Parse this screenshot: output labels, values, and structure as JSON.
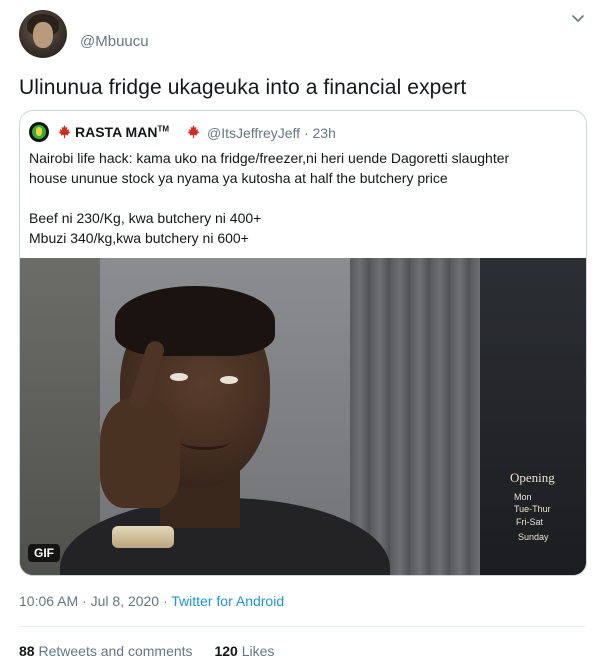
{
  "author": {
    "handle": "@Mbuucu"
  },
  "tweet": {
    "text": "Ulinunua fridge ukageuka into a financial expert"
  },
  "quoted": {
    "name": "RASTA MAN",
    "tm": "TM",
    "handle_time": "@ItsJeffreyJeff · 23h",
    "lines": [
      "Nairobi life hack: kama uko na fridge/freezer,ni heri uende Dagoretti slaughter",
      "house ununue stock ya  nyama ya kutosha at half the butchery price",
      "Beef ni 230/Kg, kwa butchery ni 400+",
      "Mbuzi 340/kg,kwa butchery ni 600+"
    ],
    "media_badge": "GIF",
    "sign": {
      "open": "Opening",
      "days": [
        "Mon",
        "Tue-Thur",
        "Fri-Sat",
        "Sunday"
      ]
    }
  },
  "meta": {
    "time": "10:06 AM · Jul 8, 2020 · ",
    "source": "Twitter for Android"
  },
  "stats": {
    "retweets_count": "88",
    "retweets_label": "Retweets and comments",
    "likes_count": "120",
    "likes_label": "Likes"
  },
  "colors": {
    "link": "#1b95e0",
    "muted": "#657786",
    "text": "#14171a",
    "flag": "#d52b1e"
  },
  "icons": [
    "chevron-down-icon",
    "maple-leaf-icon",
    "avatar"
  ]
}
